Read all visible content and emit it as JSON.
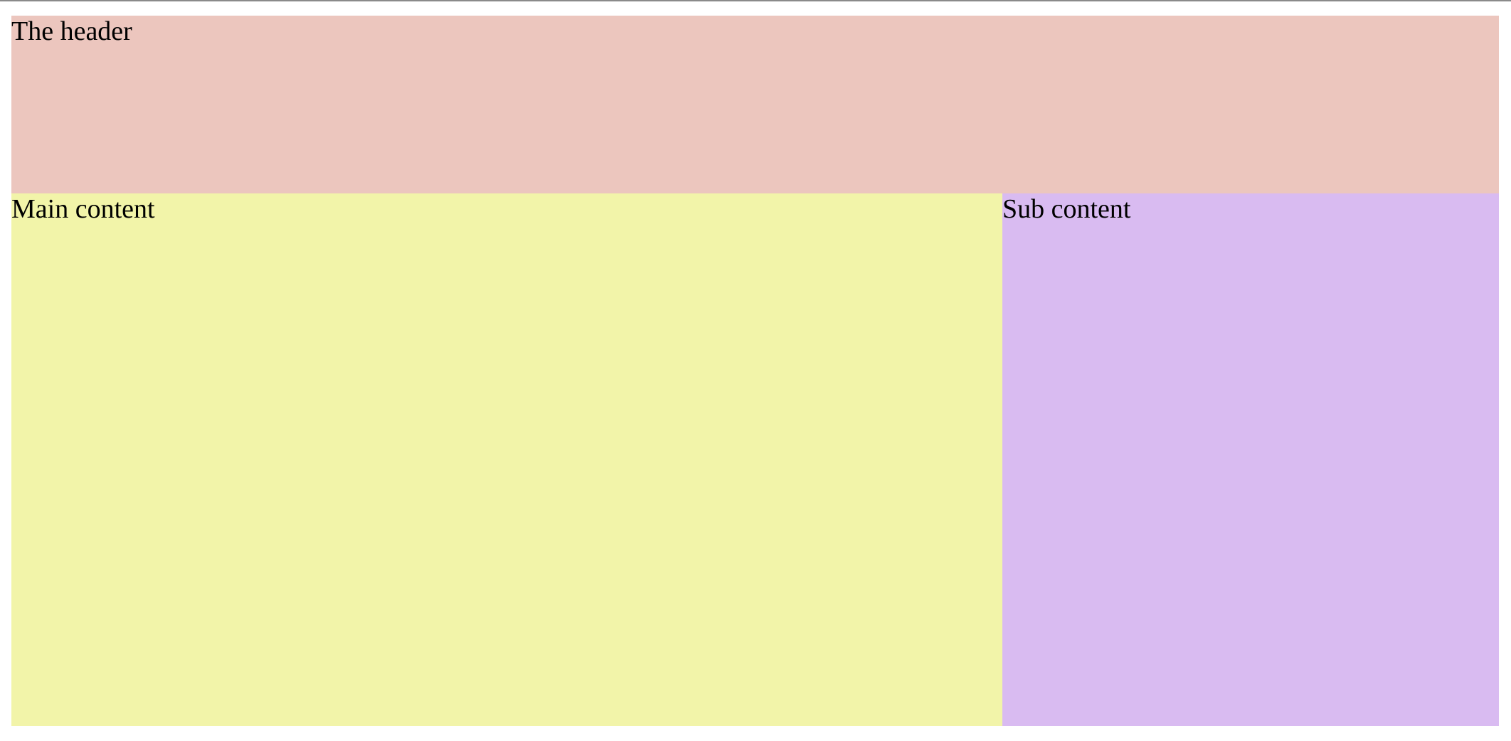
{
  "header": {
    "text": "The header",
    "background": "#ecc6be"
  },
  "main": {
    "text": "Main content",
    "background": "#f2f4a9"
  },
  "sub": {
    "text": "Sub content",
    "background": "#d9bbf1"
  }
}
